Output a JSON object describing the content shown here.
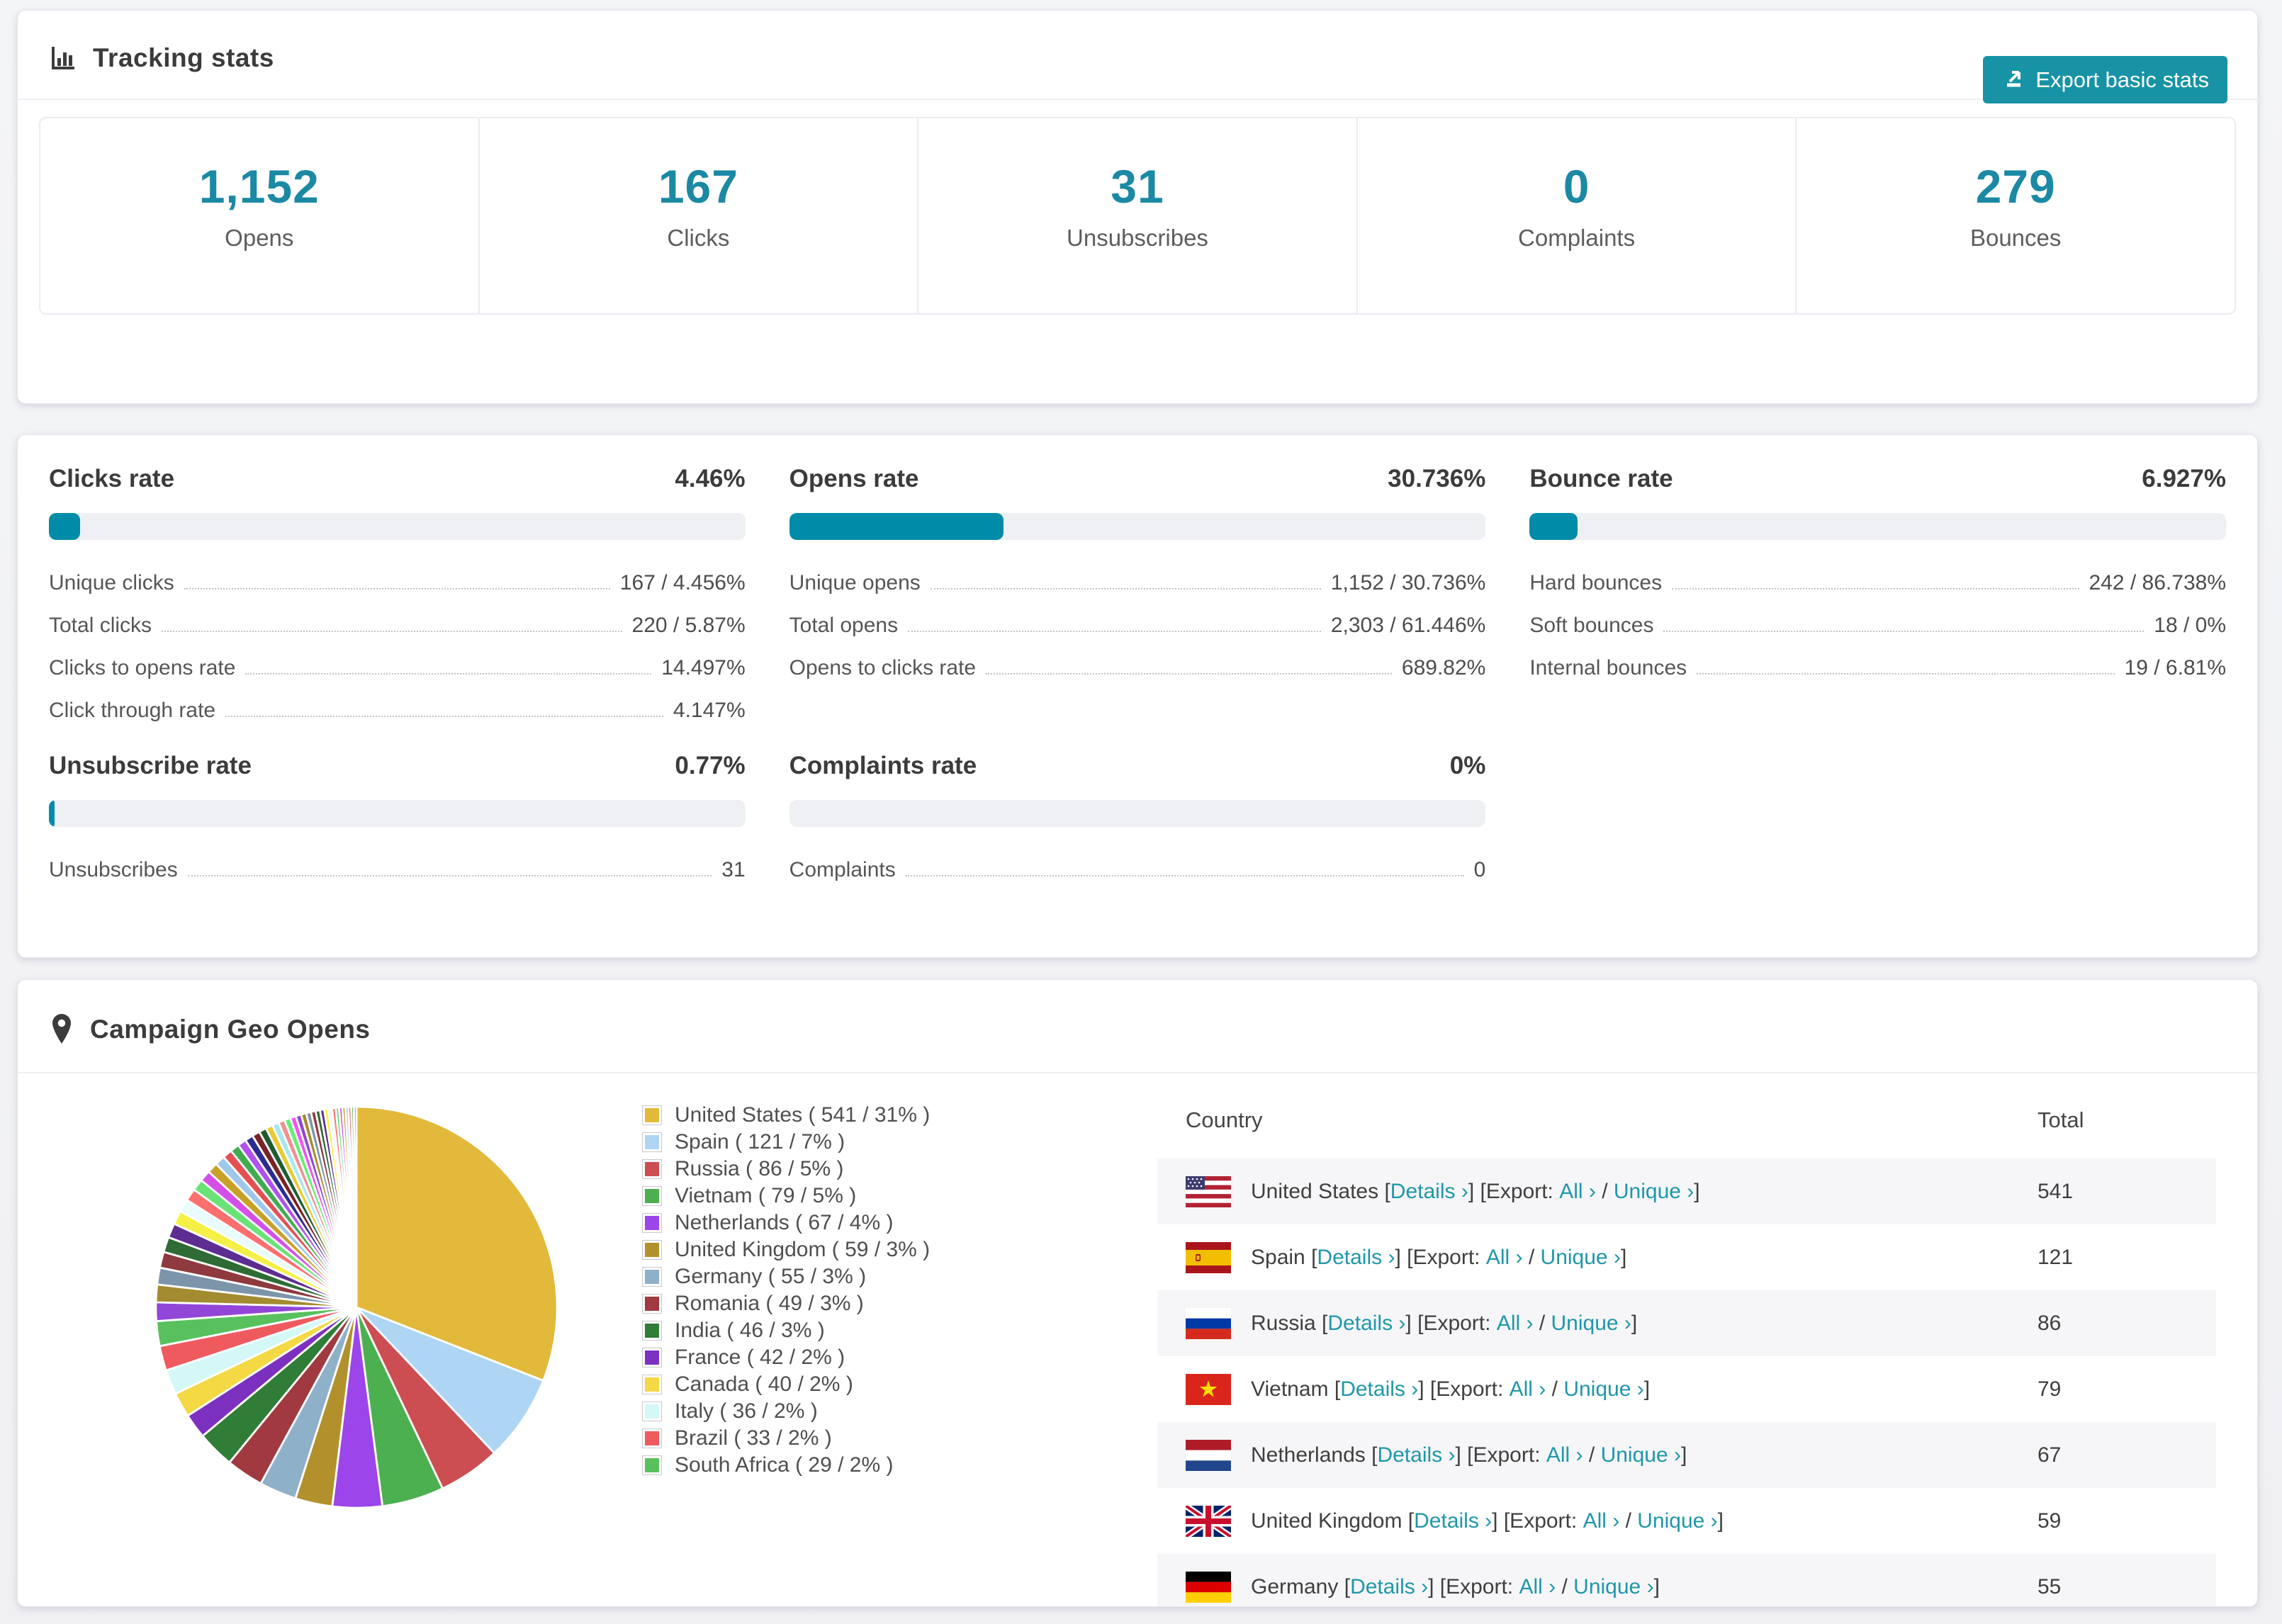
{
  "brand": {
    "teal_button": "#1793a5",
    "teal_number": "#1b89a4",
    "teal_link": "#1f97a9",
    "bar_fill": "#008ca8",
    "bar_track": "#eef0f3"
  },
  "tracking": {
    "title": "Tracking stats",
    "export_button": "Export basic stats",
    "stats": [
      {
        "value": "1,152",
        "label": "Opens"
      },
      {
        "value": "167",
        "label": "Clicks"
      },
      {
        "value": "31",
        "label": "Unsubscribes"
      },
      {
        "value": "0",
        "label": "Complaints"
      },
      {
        "value": "279",
        "label": "Bounces"
      }
    ]
  },
  "rates": [
    {
      "title": "Clicks rate",
      "value": "4.46%",
      "percent": 4.46,
      "rows": [
        {
          "label": "Unique clicks",
          "value": "167 / 4.456%"
        },
        {
          "label": "Total clicks",
          "value": "220 / 5.87%"
        },
        {
          "label": "Clicks to opens rate",
          "value": "14.497%"
        },
        {
          "label": "Click through rate",
          "value": "4.147%"
        }
      ]
    },
    {
      "title": "Opens rate",
      "value": "30.736%",
      "percent": 30.736,
      "rows": [
        {
          "label": "Unique opens",
          "value": "1,152 / 30.736%"
        },
        {
          "label": "Total opens",
          "value": "2,303 / 61.446%"
        },
        {
          "label": "Opens to clicks rate",
          "value": "689.82%"
        }
      ]
    },
    {
      "title": "Bounce rate",
      "value": "6.927%",
      "percent": 6.927,
      "rows": [
        {
          "label": "Hard bounces",
          "value": "242 / 86.738%"
        },
        {
          "label": "Soft bounces",
          "value": "18 / 0%"
        },
        {
          "label": "Internal bounces",
          "value": "19 / 6.81%"
        }
      ]
    },
    {
      "title": "Unsubscribe rate",
      "value": "0.77%",
      "percent": 0.77,
      "rows": [
        {
          "label": "Unsubscribes",
          "value": "31"
        }
      ]
    },
    {
      "title": "Complaints rate",
      "value": "0%",
      "percent": 0,
      "rows": [
        {
          "label": "Complaints",
          "value": "0"
        }
      ]
    }
  ],
  "geo": {
    "title": "Campaign Geo Opens",
    "table": {
      "country_header": "Country",
      "total_header": "Total",
      "links": {
        "bracket_open": "[",
        "bracket_close": "]",
        "details": "Details ›",
        "export_prefix": "[Export:",
        "all": "All ›",
        "slash": "/",
        "unique": "Unique ›"
      },
      "rows": [
        {
          "country": "United States",
          "total": "541",
          "flag": "us"
        },
        {
          "country": "Spain",
          "total": "121",
          "flag": "es"
        },
        {
          "country": "Russia",
          "total": "86",
          "flag": "ru"
        },
        {
          "country": "Vietnam",
          "total": "79",
          "flag": "vn"
        },
        {
          "country": "Netherlands",
          "total": "67",
          "flag": "nl"
        },
        {
          "country": "United Kingdom",
          "total": "59",
          "flag": "gb"
        },
        {
          "country": "Germany",
          "total": "55",
          "flag": "de"
        }
      ]
    }
  },
  "chart_data": {
    "type": "pie",
    "title": "Campaign Geo Opens",
    "legend_position": "right-of-pie",
    "start_angle": "12 o'clock, clockwise",
    "slices": [
      {
        "label": "United States",
        "count": 541,
        "percent": 31,
        "color": "#e2b93b"
      },
      {
        "label": "Spain",
        "count": 121,
        "percent": 7,
        "color": "#aed6f4"
      },
      {
        "label": "Russia",
        "count": 86,
        "percent": 5,
        "color": "#cc4d52"
      },
      {
        "label": "Vietnam",
        "count": 79,
        "percent": 5,
        "color": "#4caf50"
      },
      {
        "label": "Netherlands",
        "count": 67,
        "percent": 4,
        "color": "#9b45ea"
      },
      {
        "label": "United Kingdom",
        "count": 59,
        "percent": 3,
        "color": "#b2902c"
      },
      {
        "label": "Germany",
        "count": 55,
        "percent": 3,
        "color": "#8fb0c9"
      },
      {
        "label": "Romania",
        "count": 49,
        "percent": 3,
        "color": "#a03a40"
      },
      {
        "label": "India",
        "count": 46,
        "percent": 3,
        "color": "#2f7d36"
      },
      {
        "label": "France",
        "count": 42,
        "percent": 2,
        "color": "#7c30c0"
      },
      {
        "label": "Canada",
        "count": 40,
        "percent": 2,
        "color": "#f4d844"
      },
      {
        "label": "Italy",
        "count": 36,
        "percent": 2,
        "color": "#d4f8f8"
      },
      {
        "label": "Brazil",
        "count": 33,
        "percent": 2,
        "color": "#ef5a5e"
      },
      {
        "label": "South Africa",
        "count": 29,
        "percent": 2,
        "color": "#58c15e"
      }
    ],
    "legend_format": "{label} ( {count} / {percent}% )",
    "other_slices_estimated": {
      "note": "long tail of unlabeled small countries, ~26% combined",
      "values": [
        1.5,
        1.425,
        1.354,
        1.286,
        1.222,
        1.161,
        1.103,
        1.047,
        0.995,
        0.945,
        0.898,
        0.853,
        0.81,
        0.77,
        0.731,
        0.695,
        0.66,
        0.627,
        0.596,
        0.566,
        0.538,
        0.511,
        0.485,
        0.461,
        0.438,
        0.416,
        0.395,
        0.375,
        0.356,
        0.339,
        0.322,
        0.306,
        0.29,
        0.276,
        0.262,
        0.249,
        0.236,
        0.225,
        0.213,
        0.203
      ],
      "palette": [
        "#9146d8",
        "#a38b2f",
        "#7d95aa",
        "#8e3a3e",
        "#2f6b35",
        "#5e2d92",
        "#f5f046",
        "#e9fbfc",
        "#fd6e6e",
        "#69e276",
        "#d44fe8",
        "#c7a028",
        "#9ec7ea",
        "#e64f52",
        "#41ab4d",
        "#b150ef",
        "#2c2c90",
        "#7c2125",
        "#1d5c31",
        "#e8ca35",
        "#a5e8f2",
        "#f28f8f",
        "#5ef06e",
        "#ef52ef"
      ]
    }
  }
}
